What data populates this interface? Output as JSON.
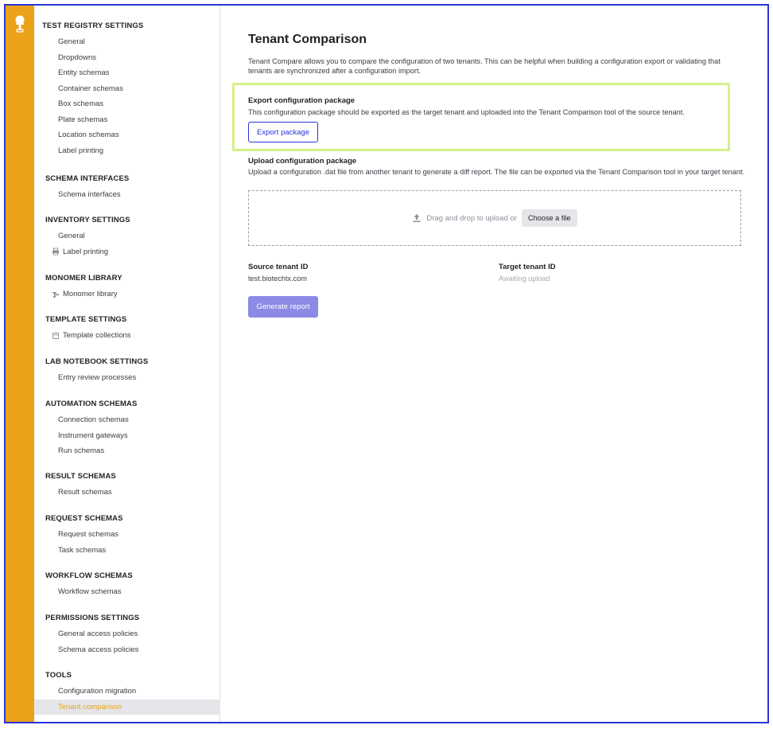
{
  "sidebar": {
    "sections": [
      {
        "header": "TEST REGISTRY SETTINGS",
        "items": [
          {
            "label": "General"
          },
          {
            "label": "Dropdowns"
          },
          {
            "label": "Entity schemas"
          },
          {
            "label": "Container schemas"
          },
          {
            "label": "Box schemas"
          },
          {
            "label": "Plate schemas"
          },
          {
            "label": "Location schemas"
          },
          {
            "label": "Label printing"
          }
        ]
      },
      {
        "header": "SCHEMA INTERFACES",
        "items": [
          {
            "label": "Schema interfaces"
          }
        ]
      },
      {
        "header": "INVENTORY SETTINGS",
        "items": [
          {
            "label": "General"
          },
          {
            "label": "Label printing",
            "icon": "printer-icon"
          }
        ]
      },
      {
        "header": "MONOMER LIBRARY",
        "items": [
          {
            "label": "Monomer library",
            "icon": "monomer-icon"
          }
        ]
      },
      {
        "header": "TEMPLATE SETTINGS",
        "items": [
          {
            "label": "Template collections",
            "icon": "template-icon"
          }
        ]
      },
      {
        "header": "LAB NOTEBOOK SETTINGS",
        "items": [
          {
            "label": "Entry review processes"
          }
        ]
      },
      {
        "header": "AUTOMATION SCHEMAS",
        "items": [
          {
            "label": "Connection schemas"
          },
          {
            "label": "Instrument gateways"
          },
          {
            "label": "Run schemas"
          }
        ]
      },
      {
        "header": "RESULT SCHEMAS",
        "items": [
          {
            "label": "Result schemas"
          }
        ]
      },
      {
        "header": "REQUEST SCHEMAS",
        "items": [
          {
            "label": "Request schemas"
          },
          {
            "label": "Task schemas"
          }
        ]
      },
      {
        "header": "WORKFLOW SCHEMAS",
        "items": [
          {
            "label": "Workflow schemas"
          }
        ]
      },
      {
        "header": "PERMISSIONS SETTINGS",
        "items": [
          {
            "label": "General access policies"
          },
          {
            "label": "Schema access policies"
          }
        ]
      },
      {
        "header": "TOOLS",
        "items": [
          {
            "label": "Configuration migration"
          },
          {
            "label": "Tenant comparison",
            "active": true
          }
        ]
      }
    ]
  },
  "main": {
    "title": "Tenant Comparison",
    "intro": "Tenant Compare allows you to compare the configuration of two tenants. This can be helpful when building a configuration export or validating that tenants are synchronized after a configuration import.",
    "export": {
      "title": "Export configuration package",
      "description": "This configuration package should be exported as the target tenant and uploaded into the Tenant Comparison tool of the source tenant.",
      "button": "Export package"
    },
    "upload": {
      "title": "Upload configuration package",
      "description": "Upload a configuration .dat file from another tenant to generate a diff report. The file can be exported via the Tenant Comparison tool in your target tenant.",
      "dropzone_text": "Drag and drop to upload or",
      "choose_button": "Choose a file"
    },
    "source": {
      "label": "Source tenant ID",
      "value": "test.biotechtx.com"
    },
    "target": {
      "label": "Target tenant ID",
      "value": "Awaiting upload"
    },
    "generate_button": "Generate report"
  },
  "colors": {
    "rail": "#eaa21b",
    "accent": "#2b33d9",
    "highlight_box": "#d6f089",
    "primary_disabled": "#8b8ae4"
  }
}
